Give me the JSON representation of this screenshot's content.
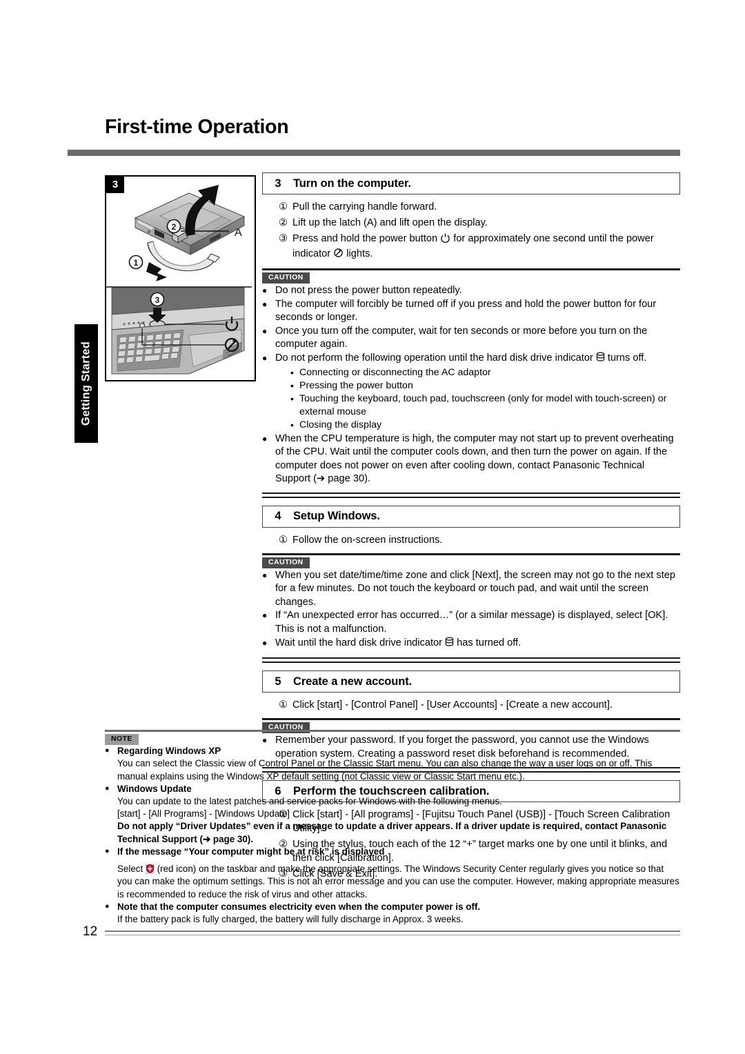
{
  "document": {
    "title": "First-time Operation",
    "side_tab": "Getting Started",
    "page_number": "12"
  },
  "illustration": {
    "panel_number": "3",
    "callouts": [
      "1",
      "2",
      "3",
      "A"
    ],
    "icons": [
      "power-button-icon",
      "power-indicator-icon"
    ]
  },
  "steps": [
    {
      "number": "3",
      "title": "Turn on the computer.",
      "items": [
        {
          "marker": "①",
          "text": "Pull the carrying handle forward."
        },
        {
          "marker": "②",
          "text": "Lift up the latch (A) and lift open the display."
        },
        {
          "marker": "③",
          "text_before": "Press and hold the power button",
          "icon1": "power-button-icon",
          "text_mid": "for approximately one second until the power indicator",
          "icon2": "power-indicator-icon",
          "text_after": "lights."
        }
      ],
      "admonition": {
        "badge": "CAUTION",
        "bullets": [
          {
            "text": "Do not press the power button repeatedly."
          },
          {
            "text": "The computer will forcibly be turned off if you press and hold the power button for four seconds or longer."
          },
          {
            "text": "Once you turn off the computer, wait for ten seconds or more before you turn on the computer again."
          },
          {
            "text_before": "Do not perform the following operation until the hard disk drive indicator",
            "icon": "hard-disk-drive-icon",
            "text_after": "turns off.",
            "sub": [
              "Connecting or disconnecting the AC adaptor",
              "Pressing the power button",
              "Touching the keyboard, touch pad, touchscreen (only for model with touch-screen) or external mouse",
              "Closing the display"
            ]
          },
          {
            "text": "When the CPU temperature is high, the computer may not start up to prevent overheating of the CPU. Wait until the computer cools down, and then turn the power on again. If the computer does not power on even after cooling down, contact Panasonic Technical Support (➔ page 30)."
          }
        ]
      }
    },
    {
      "number": "4",
      "title": "Setup Windows.",
      "items": [
        {
          "marker": "①",
          "text": "Follow the on-screen instructions."
        }
      ],
      "admonition": {
        "badge": "CAUTION",
        "bullets": [
          {
            "text": "When you set date/time/time zone and click [Next], the screen may not go to the next step for a few minutes. Do not touch the keyboard or touch pad, and wait until the screen changes."
          },
          {
            "text": "If “An unexpected error has occurred…” (or a similar message) is displayed, select [OK]. This is not a malfunction."
          },
          {
            "text_before": "Wait until the hard disk drive indicator",
            "icon": "hard-disk-drive-icon",
            "text_after": "has turned off."
          }
        ]
      }
    },
    {
      "number": "5",
      "title": "Create a new account.",
      "items": [
        {
          "marker": "①",
          "text": "Click [start] - [Control Panel] - [User Accounts] - [Create a new account]."
        }
      ],
      "admonition": {
        "badge": "CAUTION",
        "bullets": [
          {
            "text": "Remember your password. If you forget the password, you cannot use the Windows operation system. Creating a password reset disk beforehand is recommended."
          }
        ]
      }
    },
    {
      "number": "6",
      "title": "Perform the touchscreen calibration.",
      "items": [
        {
          "marker": "①",
          "text": "Click [start] - [All programs] - [Fujitsu Touch Panel (USB)] - [Touch Screen Calibration Utility]."
        },
        {
          "marker": "②",
          "text": "Using the stylus, touch each of the 12 “+” target marks one by one until it blinks, and then click [Calibration]."
        },
        {
          "marker": "③",
          "text": "Click [Save & Exit]."
        }
      ]
    }
  ],
  "note": {
    "badge": "NOTE",
    "entries": [
      {
        "heading": "Regarding Windows XP",
        "body": "You can select the Classic view of Control Panel or the Classic Start menu. You can also change the way a user logs on or off. This manual explains using the Windows XP default setting (not Classic view or Classic Start menu etc.)."
      },
      {
        "heading": "Windows Update",
        "body": "You can update to the latest patches and service packs for Windows with the following menus.",
        "body2": "[start] - [All Programs] - [Windows Update]",
        "body_bold": "Do not apply “Driver Updates” even if a message to update a driver appears. If a driver update is required, contact Panasonic Technical Support (➔ page 30)."
      },
      {
        "heading": "If the message “Your computer might be at risk” is displayed",
        "body_icon_before": "Select",
        "icon": "security-shield-icon",
        "body_icon_after": "(red icon) on the taskbar and make the appropriate settings. The Windows Security Center regularly gives you notice so that you can make the optimum settings. This is not an error message and you can use the computer. However, making appropriate measures is recommended to reduce the risk of virus and other attacks."
      },
      {
        "heading": "Note that the computer consumes electricity even when the computer power is off.",
        "body": "If the battery pack is fully charged, the battery will fully discharge in Approx. 3 weeks."
      }
    ]
  },
  "colors": {
    "header_rule": "#6b6b6b",
    "caution_badge_bg": "#4a4a4a",
    "note_badge_bg": "#9a9a9a",
    "shield_red": "#c8102e"
  }
}
